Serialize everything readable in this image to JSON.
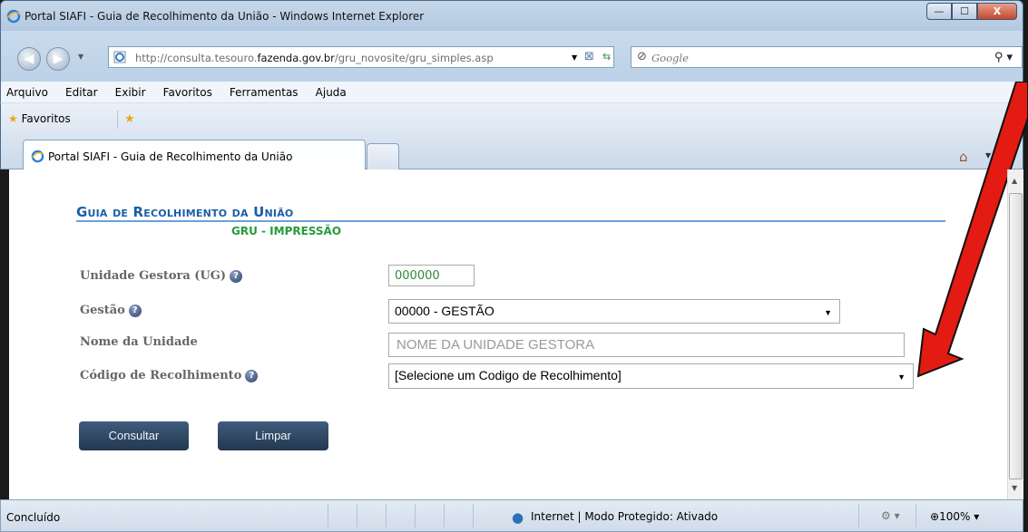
{
  "window": {
    "title": "Portal SIAFI - Guia de Recolhimento da União - Windows Internet Explorer",
    "buttons": {
      "minimize": "—",
      "maximize": "☐",
      "close": "X"
    }
  },
  "address_bar": {
    "url_prefix": "http://consulta.tesouro.",
    "url_domain": "fazenda.gov.br",
    "url_suffix": "/gru_novosite/gru_simples.asp",
    "search_placeholder": "Google"
  },
  "menu": [
    "Arquivo",
    "Editar",
    "Exibir",
    "Favoritos",
    "Ferramentas",
    "Ajuda"
  ],
  "favorites_bar": {
    "label": "Favoritos"
  },
  "tab": {
    "label": "Portal SIAFI - Guia de Recolhimento da União"
  },
  "page": {
    "title": "Guia de Recolhimento da União",
    "subtitle": "GRU - IMPRESSÃO",
    "fields": {
      "ug_label": "Unidade Gestora (UG)",
      "ug_value": "000000",
      "gestao_label": "Gestão",
      "gestao_value": "00000 - GESTÃO",
      "nome_label": "Nome da Unidade",
      "nome_placeholder": "NOME DA UNIDADE GESTORA",
      "codigo_label": "Código de Recolhimento",
      "codigo_value": "[Selecione um Codigo de Recolhimento]"
    },
    "buttons": {
      "consultar": "Consultar",
      "limpar": "Limpar"
    },
    "help_glyph": "?",
    "annotation_color": "#e31b12"
  },
  "status_bar": {
    "status": "Concluído",
    "zone": "Internet | Modo Protegido: Ativado",
    "zoom": "100%"
  }
}
